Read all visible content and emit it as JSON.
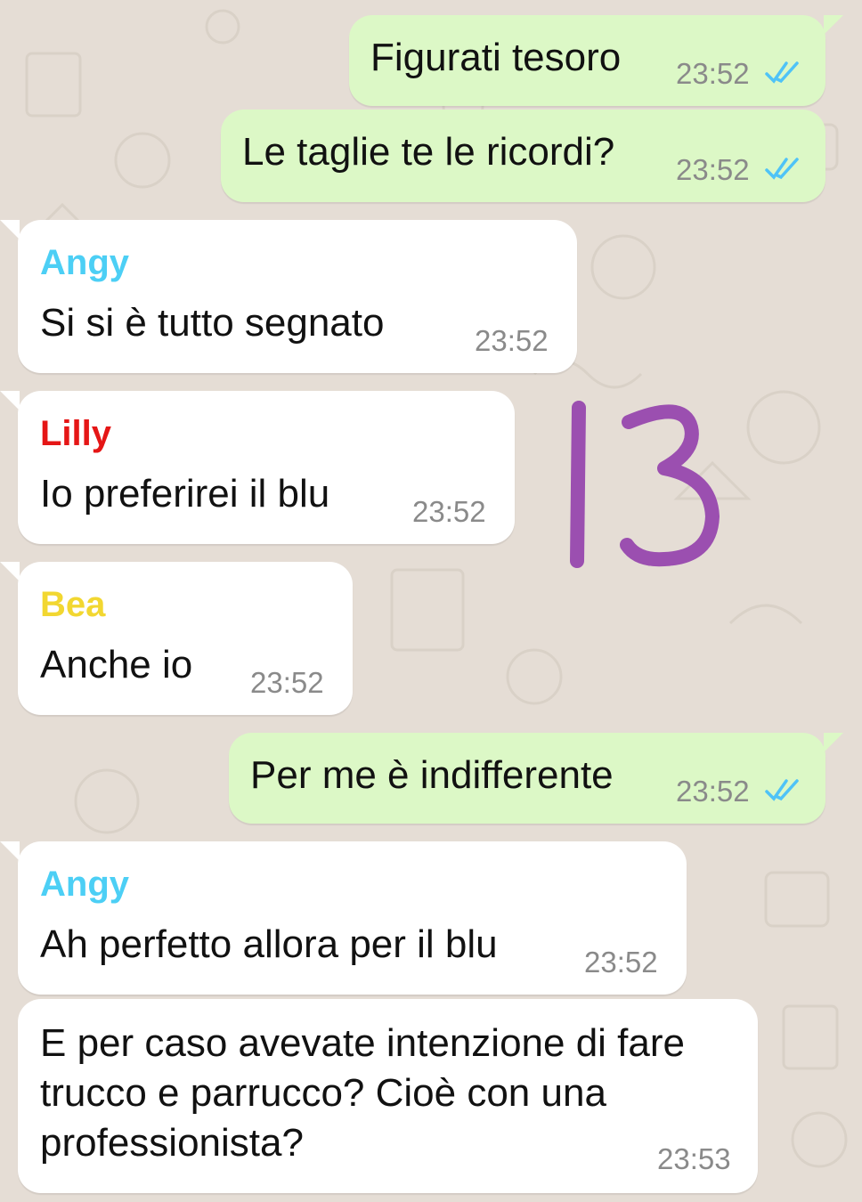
{
  "colors": {
    "background": "#e5ddd5",
    "outgoing_bubble": "#dcf8c6",
    "incoming_bubble": "#ffffff",
    "read_ticks": "#4fc3f7",
    "annotation": "#9b4fb0"
  },
  "messages": [
    {
      "direction": "out",
      "text": "Figurati tesoro",
      "time": "23:52",
      "status_icon": "double-check-read-icon"
    },
    {
      "direction": "out",
      "text": "Le taglie te le ricordi?",
      "time": "23:52",
      "status_icon": "double-check-read-icon"
    },
    {
      "direction": "in",
      "sender": "Angy",
      "sender_color": "#4ccff5",
      "text": "Si si è tutto segnato",
      "time": "23:52"
    },
    {
      "direction": "in",
      "sender": "Lilly",
      "sender_color": "#e51616",
      "text": "Io preferirei il blu",
      "time": "23:52"
    },
    {
      "direction": "in",
      "sender": "Bea",
      "sender_color": "#f2d731",
      "text": "Anche io",
      "time": "23:52"
    },
    {
      "direction": "out",
      "text": "Per me è indifferente",
      "time": "23:52",
      "status_icon": "double-check-read-icon"
    },
    {
      "direction": "in",
      "sender": "Angy",
      "sender_color": "#4ccff5",
      "text": "Ah perfetto allora per il blu",
      "time": "23:52"
    },
    {
      "direction": "in",
      "text_lines": [
        "E per caso avevate intenzione di fare",
        "trucco e parrucco? Cioè con una",
        "professionista?"
      ],
      "time": "23:53"
    }
  ],
  "annotation": {
    "text": "13"
  }
}
